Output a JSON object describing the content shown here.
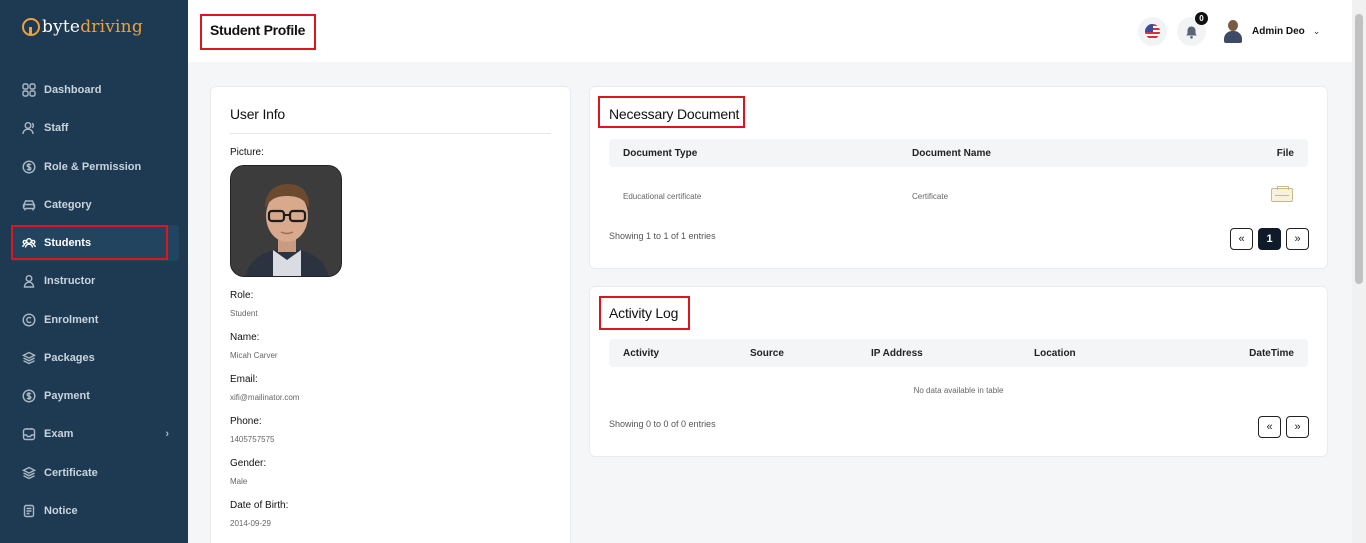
{
  "brand": {
    "name_part1": "byte",
    "name_part2": "driving"
  },
  "sidebar": {
    "items": [
      {
        "label": "Dashboard",
        "icon": "grid-icon"
      },
      {
        "label": "Staff",
        "icon": "users-icon"
      },
      {
        "label": "Role & Permission",
        "icon": "dollar-circle-icon"
      },
      {
        "label": "Category",
        "icon": "car-icon"
      },
      {
        "label": "Students",
        "icon": "group-icon"
      },
      {
        "label": "Instructor",
        "icon": "user-icon"
      },
      {
        "label": "Enrolment",
        "icon": "copyright-icon"
      },
      {
        "label": "Packages",
        "icon": "layers-icon"
      },
      {
        "label": "Payment",
        "icon": "dollar-circle-icon"
      },
      {
        "label": "Exam",
        "icon": "inbox-icon"
      },
      {
        "label": "Certificate",
        "icon": "layers-icon"
      },
      {
        "label": "Notice",
        "icon": "document-icon"
      }
    ]
  },
  "header": {
    "title": "Student Profile",
    "notification_count": "0",
    "user_name": "Admin Deo"
  },
  "user_info": {
    "title": "User Info",
    "picture_label": "Picture:",
    "fields": [
      {
        "label": "Role:",
        "value": "Student"
      },
      {
        "label": "Name:",
        "value": "Micah Carver"
      },
      {
        "label": "Email:",
        "value": "xifi@mailinator.com"
      },
      {
        "label": "Phone:",
        "value": "1405757575"
      },
      {
        "label": "Gender:",
        "value": "Male"
      },
      {
        "label": "Date of Birth:",
        "value": "2014-09-29"
      }
    ]
  },
  "documents": {
    "title": "Necessary Document",
    "columns": [
      "Document Type",
      "Document Name",
      "File"
    ],
    "rows": [
      {
        "type": "Educational certificate",
        "name": "Certificate",
        "file_icon": "certificate-file-icon"
      }
    ],
    "showing": "Showing 1 to 1 of 1 entries",
    "pagination": {
      "prev": "«",
      "current": "1",
      "next": "»"
    }
  },
  "activity_log": {
    "title": "Activity Log",
    "columns": [
      "Activity",
      "Source",
      "IP Address",
      "Location",
      "DateTime"
    ],
    "empty_text": "No data available in table",
    "showing": "Showing 0 to 0 of 0 entries",
    "pagination": {
      "prev": "«",
      "next": "»"
    }
  },
  "colors": {
    "sidebar_bg": "#1d3a52",
    "brand_accent": "#f0a039",
    "highlight": "#e0141e"
  }
}
